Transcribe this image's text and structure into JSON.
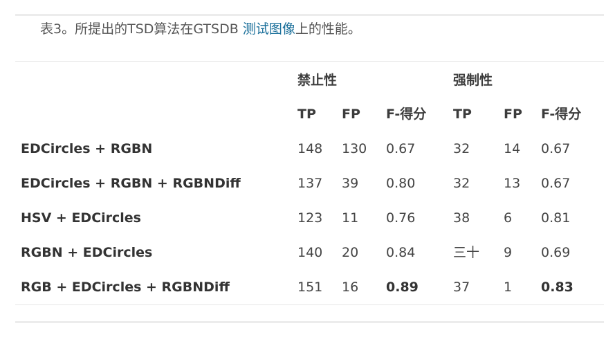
{
  "caption": {
    "prefix": "表3。所提出的TSD算法在GTSDB ",
    "link": "测试图像",
    "suffix": "上的性能。"
  },
  "table": {
    "group_headers": [
      "禁止性",
      "强制性"
    ],
    "column_headers": [
      "TP",
      "FP",
      "F-得分",
      "TP",
      "FP",
      "F-得分"
    ],
    "rows": [
      {
        "label": "EDCircles + RGBN",
        "cells": [
          "148",
          "130",
          "0.67",
          "32",
          "14",
          "0.67"
        ]
      },
      {
        "label": "EDCircles + RGBN + RGBNDiff",
        "cells": [
          "137",
          "39",
          "0.80",
          "32",
          "13",
          "0.67"
        ]
      },
      {
        "label": "HSV + EDCircles",
        "cells": [
          "123",
          "11",
          "0.76",
          "38",
          "6",
          "0.81"
        ]
      },
      {
        "label": "RGBN + EDCircles",
        "cells": [
          "140",
          "20",
          "0.84",
          "三十",
          "9",
          "0.69"
        ]
      },
      {
        "label": "RGB + EDCircles + RGBNDiff",
        "cells": [
          "151",
          "16",
          "0.89",
          "37",
          "1",
          "0.83"
        ]
      }
    ]
  },
  "colors": {
    "text": "#444444",
    "link": "#1a6f9a",
    "rule": "#ececec"
  }
}
